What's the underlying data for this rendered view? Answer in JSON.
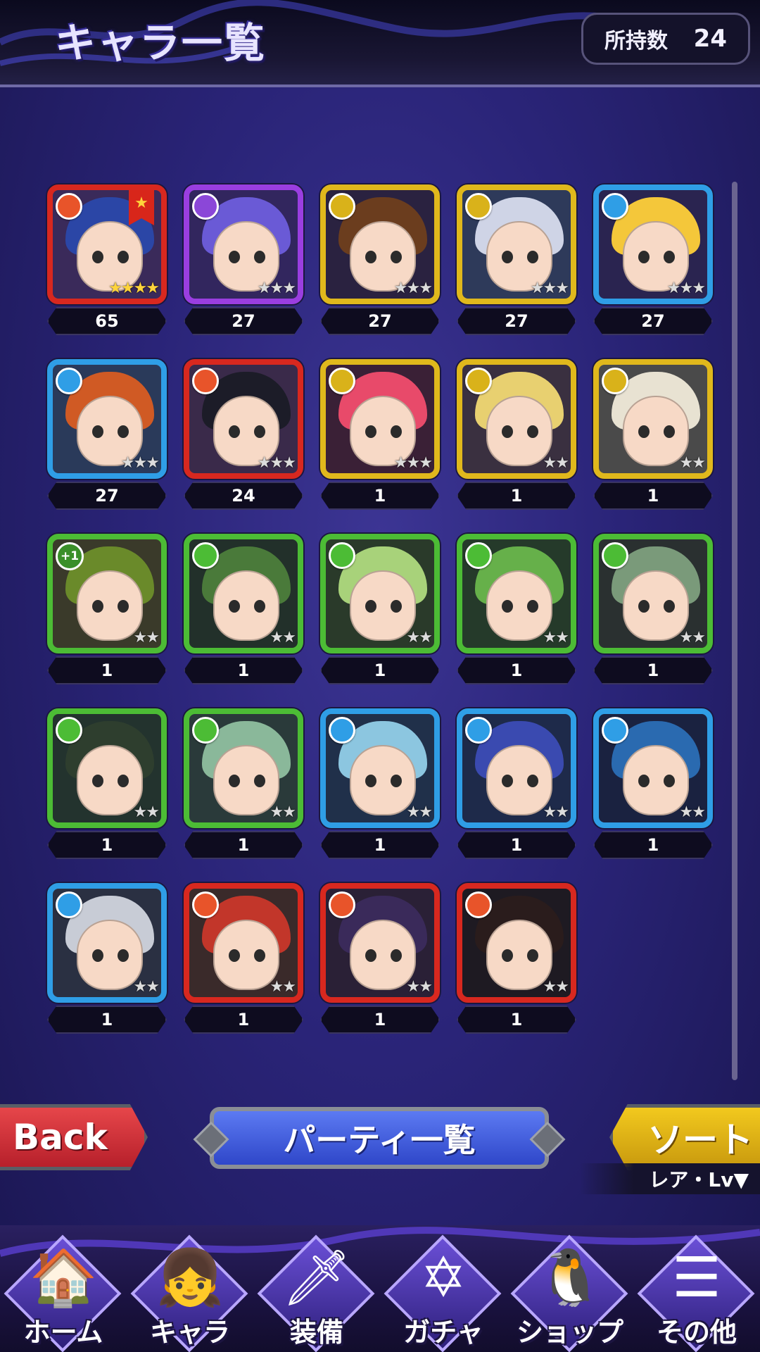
{
  "header": {
    "title": "キャラ一覧",
    "owned_label": "所持数",
    "owned_count": "24"
  },
  "characters": [
    {
      "level": "65",
      "element": "fire",
      "stars": 4,
      "gold": true,
      "banner": true,
      "frame": "#d8281f",
      "hair": "#2b46a6",
      "bg": "#3a2a5a"
    },
    {
      "level": "27",
      "element": "dark",
      "stars": 3,
      "gold": false,
      "banner": false,
      "frame": "#9a3ee0",
      "hair": "#6a5ad6",
      "bg": "#32265e"
    },
    {
      "level": "27",
      "element": "light",
      "stars": 3,
      "gold": false,
      "banner": false,
      "frame": "#e0b81c",
      "hair": "#6b3d1e",
      "bg": "#2a2240"
    },
    {
      "level": "27",
      "element": "light",
      "stars": 3,
      "gold": false,
      "banner": false,
      "frame": "#e0b81c",
      "hair": "#cfd4e6",
      "bg": "#2e3a5a"
    },
    {
      "level": "27",
      "element": "water",
      "stars": 3,
      "gold": false,
      "banner": false,
      "frame": "#2f9ee6",
      "hair": "#f4c73a",
      "bg": "#2a2450"
    },
    {
      "level": "27",
      "element": "water",
      "stars": 3,
      "gold": false,
      "banner": false,
      "frame": "#2f9ee6",
      "hair": "#d05a24",
      "bg": "#2a3a5a"
    },
    {
      "level": "24",
      "element": "fire",
      "stars": 3,
      "gold": false,
      "banner": false,
      "frame": "#d8281f",
      "hair": "#1c1c28",
      "bg": "#3a2a4a"
    },
    {
      "level": "1",
      "element": "light",
      "stars": 3,
      "gold": false,
      "banner": false,
      "frame": "#e0b81c",
      "hair": "#e84a6a",
      "bg": "#3a2036"
    },
    {
      "level": "1",
      "element": "light",
      "stars": 2,
      "gold": false,
      "banner": false,
      "frame": "#e0b81c",
      "hair": "#e8d070",
      "bg": "#3a3040"
    },
    {
      "level": "1",
      "element": "light",
      "stars": 2,
      "gold": false,
      "banner": false,
      "frame": "#e0b81c",
      "hair": "#e8e2d2",
      "bg": "#4a4a4a"
    },
    {
      "level": "1",
      "element": "plus",
      "stars": 2,
      "gold": false,
      "banner": false,
      "frame": "#4cbc35",
      "hair": "#6a8a2a",
      "bg": "#3a3a2a",
      "plus": "+1"
    },
    {
      "level": "1",
      "element": "wind",
      "stars": 2,
      "gold": false,
      "banner": false,
      "frame": "#4cbc35",
      "hair": "#4a7a3a",
      "bg": "#22302a"
    },
    {
      "level": "1",
      "element": "wind",
      "stars": 2,
      "gold": false,
      "banner": false,
      "frame": "#4cbc35",
      "hair": "#a8d27a",
      "bg": "#2a3a2a"
    },
    {
      "level": "1",
      "element": "wind",
      "stars": 2,
      "gold": false,
      "banner": false,
      "frame": "#4cbc35",
      "hair": "#66b04a",
      "bg": "#253a2a"
    },
    {
      "level": "1",
      "element": "wind",
      "stars": 2,
      "gold": false,
      "banner": false,
      "frame": "#4cbc35",
      "hair": "#7a9a7a",
      "bg": "#2a3030"
    },
    {
      "level": "1",
      "element": "wind",
      "stars": 2,
      "gold": false,
      "banner": false,
      "frame": "#4cbc35",
      "hair": "#2e3e2e",
      "bg": "#23332e"
    },
    {
      "level": "1",
      "element": "wind",
      "stars": 2,
      "gold": false,
      "banner": false,
      "frame": "#4cbc35",
      "hair": "#8ab89a",
      "bg": "#2a3a3a"
    },
    {
      "level": "1",
      "element": "water",
      "stars": 2,
      "gold": false,
      "banner": false,
      "frame": "#2f9ee6",
      "hair": "#8cc6e0",
      "bg": "#20304a"
    },
    {
      "level": "1",
      "element": "water",
      "stars": 2,
      "gold": false,
      "banner": false,
      "frame": "#2f9ee6",
      "hair": "#3a4ab0",
      "bg": "#1e2a4a"
    },
    {
      "level": "1",
      "element": "water",
      "stars": 2,
      "gold": false,
      "banner": false,
      "frame": "#2f9ee6",
      "hair": "#2a6ab0",
      "bg": "#1a2240"
    },
    {
      "level": "1",
      "element": "water",
      "stars": 2,
      "gold": false,
      "banner": false,
      "frame": "#2f9ee6",
      "hair": "#c8ccd6",
      "bg": "#2a3042"
    },
    {
      "level": "1",
      "element": "fire",
      "stars": 2,
      "gold": false,
      "banner": false,
      "frame": "#d8281f",
      "hair": "#c2362a",
      "bg": "#3a2a2a"
    },
    {
      "level": "1",
      "element": "fire",
      "stars": 2,
      "gold": false,
      "banner": false,
      "frame": "#d8281f",
      "hair": "#3a2a5a",
      "bg": "#2a2036"
    },
    {
      "level": "1",
      "element": "fire",
      "stars": 2,
      "gold": false,
      "banner": false,
      "frame": "#d8281f",
      "hair": "#2a1c1c",
      "bg": "#1e1a22"
    }
  ],
  "buttons": {
    "back": "Back",
    "party": "パーティ一覧",
    "sort": "ソート",
    "sort_mode": "レア・Lv▼"
  },
  "nav": [
    {
      "label": "ホーム",
      "icon": "🏠"
    },
    {
      "label": "キャラ",
      "icon": "👧"
    },
    {
      "label": "装備",
      "icon": "🗡"
    },
    {
      "label": "ガチャ",
      "icon": "✡"
    },
    {
      "label": "ショップ",
      "icon": "🐧"
    },
    {
      "label": "その他",
      "icon": "☰"
    }
  ]
}
